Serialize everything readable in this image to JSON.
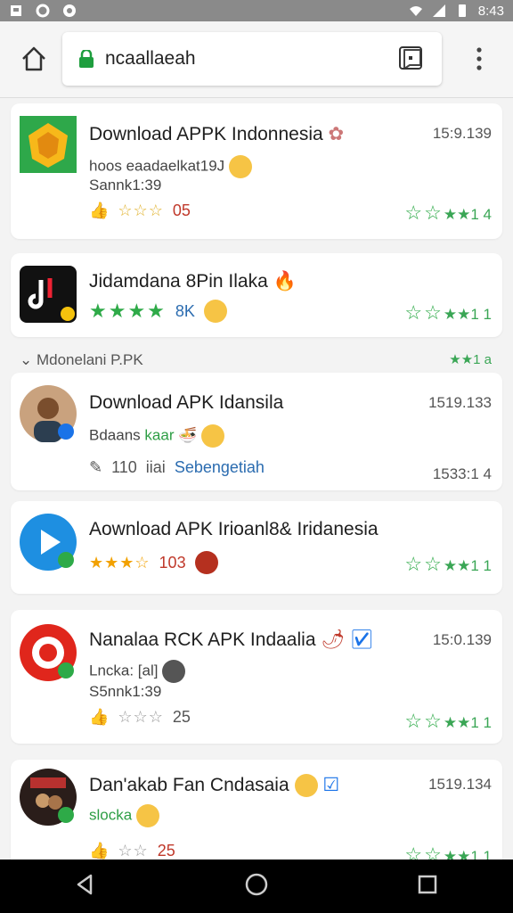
{
  "status_bar": {
    "time": "8:43"
  },
  "browser": {
    "url": "ncaallaeah"
  },
  "section": {
    "label": "Mdonelani P.PK",
    "right": "★★1 a"
  },
  "cards": [
    {
      "title": "Download APPK Indonnesia",
      "time": "15:9.139",
      "sub1": "hoos eaadaelkat19J",
      "sub2": "Sannk1:39",
      "rating": "05",
      "green_rating": "★★1 4"
    },
    {
      "title": "Jidamdana 8Pin Ilaka",
      "time": "",
      "sub1": "",
      "sub2": "",
      "rating": "8K",
      "green_rating": "★★1 1"
    },
    {
      "title": "Download APK Idansila",
      "time": "1519.133",
      "sub1": "Bdaans",
      "sub1b": "kaar",
      "sub2": "",
      "meta_count": "110",
      "meta_mid": "iiai",
      "meta_link": "Sebengetiah",
      "time2": "1533:1 4",
      "green_rating": ""
    },
    {
      "title": "Aownload APK Irioanl8& Iridanesia",
      "time": "",
      "rating": "103",
      "green_rating": "★★1 1"
    },
    {
      "title": "Nanalaa RCK APK Indaalia",
      "time": "15:0.139",
      "sub1": "Lncka: [al]",
      "sub2": "S5nnk1:39",
      "rating": "25",
      "green_rating": "★★1 1"
    },
    {
      "title": "Dan'akab Fan Cndasaia",
      "time": "1519.134",
      "sub1": "slocka",
      "rating": "25",
      "green_rating": "★★1 1"
    }
  ]
}
